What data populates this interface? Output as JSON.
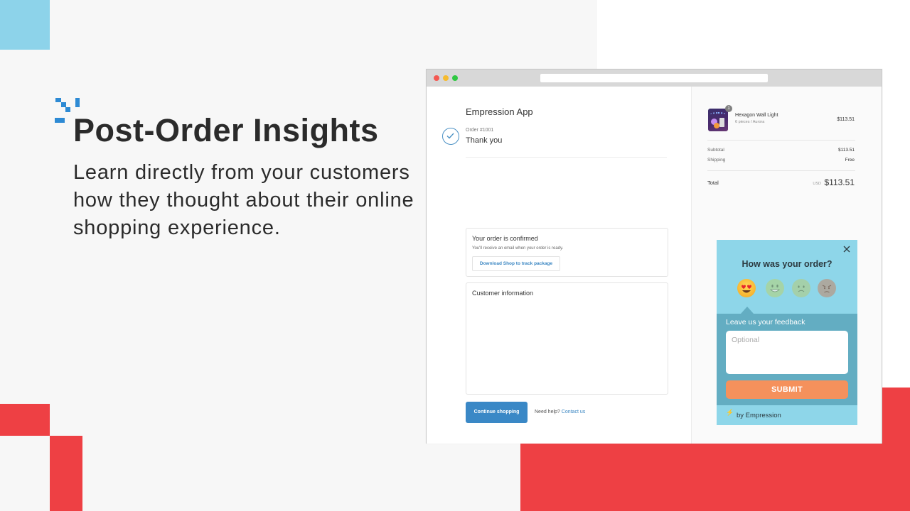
{
  "hero": {
    "title": "Post-Order Insights",
    "description": "Learn directly from your customers how they thought about their online shopping experience."
  },
  "colors": {
    "accent_blue": "#2d8ad4",
    "deco_red": "#ee4044",
    "deco_light_blue": "#8dd3ea",
    "widget_bg": "#8ed6e9",
    "widget_dark": "#63adc2",
    "submit_orange": "#f5915c",
    "button_blue": "#3a88c6"
  },
  "checkout": {
    "store_name": "Empression App",
    "order_number": "Order #1001",
    "thank_you": "Thank you",
    "confirm_card": {
      "title": "Your order is confirmed",
      "subtitle": "You'll receive an email when your order is ready.",
      "button": "Download Shop to track package"
    },
    "customer_card": {
      "title": "Customer information"
    },
    "continue_button": "Continue shopping",
    "help_text": "Need help?",
    "help_link": "Contact us"
  },
  "summary": {
    "product": {
      "name": "Hexagon Wall Light",
      "variant": "6 pieces / Aurora",
      "price": "$113.51",
      "quantity": "1"
    },
    "subtotal_label": "Subtotal",
    "subtotal_value": "$113.51",
    "shipping_label": "Shipping",
    "shipping_value": "Free",
    "total_label": "Total",
    "total_currency": "USD",
    "total_value": "$113.51"
  },
  "widget": {
    "question": "How was your order?",
    "ratings": [
      {
        "name": "heart-eyes",
        "selected": true
      },
      {
        "name": "grinning",
        "selected": false
      },
      {
        "name": "frowning",
        "selected": false
      },
      {
        "name": "angry",
        "selected": false
      }
    ],
    "feedback_label": "Leave us your feedback",
    "feedback_placeholder": "Optional",
    "feedback_value": "",
    "submit_label": "SUBMIT",
    "branding": "by Empression"
  }
}
